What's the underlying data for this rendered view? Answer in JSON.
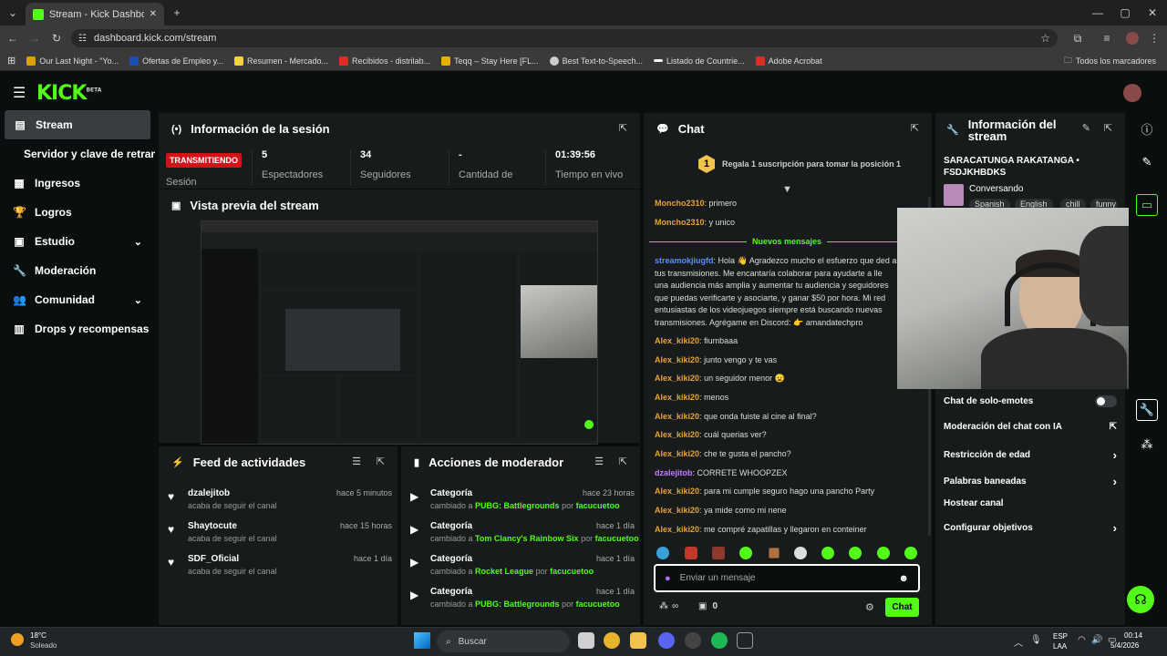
{
  "browser": {
    "tab_title": "Stream - Kick Dashboard",
    "url": "dashboard.kick.com/stream",
    "bookmarks": [
      "Our Last Night - \"Yo...",
      "Ofertas de Empleo y...",
      "Resumen - Mercado...",
      "Recibidos - distrilab...",
      "Teqq – Stay Here [FL...",
      "Best Text-to-Speech...",
      "Listado de Countrie...",
      "Adobe Acrobat"
    ],
    "all_bookmarks": "Todos los marcadores"
  },
  "app": {
    "logo": "KICK",
    "logo_badge": "BETA"
  },
  "sidebar": {
    "items": [
      {
        "label": "Stream"
      },
      {
        "label": "Servidor y clave de retransmisión"
      },
      {
        "label": "Ingresos"
      },
      {
        "label": "Logros"
      },
      {
        "label": "Estudio"
      },
      {
        "label": "Moderación"
      },
      {
        "label": "Comunidad"
      },
      {
        "label": "Drops y recompensas"
      }
    ]
  },
  "session": {
    "title": "Información de la sesión",
    "live_badge": "TRANSMITIENDO",
    "session_label": "Sesión",
    "stats": [
      {
        "value": "5",
        "label": "Espectadores"
      },
      {
        "value": "34",
        "label": "Seguidores"
      },
      {
        "value": "-",
        "label": "Cantidad de"
      },
      {
        "value": "01:39:56",
        "label": "Tiempo en vivo"
      }
    ]
  },
  "preview": {
    "title": "Vista previa del stream"
  },
  "feed": {
    "title": "Feed de actividades",
    "items": [
      {
        "name": "dzalejitob",
        "action": "acaba de seguir el canal",
        "time": "hace 5 minutos"
      },
      {
        "name": "Shaytocute",
        "action": "acaba de seguir el canal",
        "time": "hace 15 horas"
      },
      {
        "name": "SDF_Oficial",
        "action": "acaba de seguir el canal",
        "time": "hace 1 día"
      }
    ]
  },
  "mod_actions": {
    "title": "Acciones de moderador",
    "items": [
      {
        "name": "Categoría",
        "prefix": "cambiado a",
        "game": "PUBG: Battlegrounds",
        "by": "por",
        "mod": "facucuetoo",
        "time": "hace 23 horas"
      },
      {
        "name": "Categoría",
        "prefix": "cambiado a",
        "game": "Tom Clancy's Rainbow Six",
        "by": "por",
        "mod": "facucuetoo",
        "time": "hace 1 día"
      },
      {
        "name": "Categoría",
        "prefix": "cambiado a",
        "game": "Rocket League",
        "by": "por",
        "mod": "facucuetoo",
        "time": "hace 1 día"
      },
      {
        "name": "Categoría",
        "prefix": "cambiado a",
        "game": "PUBG: Battlegrounds",
        "by": "por",
        "mod": "facucuetoo",
        "time": "hace 1 día"
      }
    ]
  },
  "chat": {
    "title": "Chat",
    "gift_rank": "1",
    "gift_text": "Regala 1 suscripción para tomar la posición 1",
    "new_messages": "Nuevos mensajes",
    "messages_before": [
      {
        "user": "Moncho2310",
        "text": "primero"
      },
      {
        "user": "Moncho2310",
        "text": "y unico"
      }
    ],
    "spam": {
      "user": "streamokjiugfd",
      "text": "Hola 👋 Agradezco mucho el esfuerzo que ded a tus transmisiones. Me encantaría colaborar para ayudarte a lle una audiencia más amplia y aumentar tu audiencia y seguidores que puedas verificarte y asociarte, y ganar $50 por hora. Mi red entusiastas de los videojuegos siempre está buscando nuevas transmisiones. Agrégame en Discord: 👉 amandatechpro"
    },
    "messages_after": [
      {
        "user": "Alex_kiki20",
        "text": "fiumbaaa"
      },
      {
        "user": "Alex_kiki20",
        "text": "junto vengo y te vas"
      },
      {
        "user": "Alex_kiki20",
        "text": "un seguidor menor 😦"
      },
      {
        "user": "Alex_kiki20",
        "text": "menos"
      },
      {
        "user": "Alex_kiki20",
        "text": "que onda fuiste al cine al final?"
      },
      {
        "user": "Alex_kiki20",
        "text": "cuál querias ver?"
      },
      {
        "user": "Alex_kiki20",
        "text": "che te gusta el pancho?"
      },
      {
        "user": "dzalejitob",
        "text": "CORRETE WHOOPZEX"
      },
      {
        "user": "Alex_kiki20",
        "text": "para mi cumple seguro hago una pancho Party"
      },
      {
        "user": "Alex_kiki20",
        "text": "ya mide como mi nene"
      },
      {
        "user": "Alex_kiki20",
        "text": "me compré zapatillas y llegaron en conteiner"
      }
    ],
    "placeholder": "Enviar un mensaje",
    "points": "∞",
    "count": "0",
    "send": "Chat"
  },
  "stream_info": {
    "title": "Información del stream",
    "stream_title": "SARACATUNGA RAKATANGA • FSDJKHBDKS",
    "category": "Conversando",
    "tags": [
      "Spanish",
      "English",
      "chill",
      "funny"
    ],
    "settings": [
      {
        "label": "Chat de solo-emotes"
      },
      {
        "label": "Moderación del chat con IA"
      },
      {
        "label": "Restricción de edad"
      },
      {
        "label": "Palabras baneadas"
      },
      {
        "label": "Hostear canal"
      },
      {
        "label": "Configurar objetivos"
      }
    ]
  },
  "taskbar": {
    "weather_temp": "18°C",
    "weather_desc": "Soleado",
    "search": "Buscar",
    "lang": "ESP",
    "lang2": "LAA",
    "time": "00:14",
    "date": "5/4/2026"
  },
  "colors": {
    "accent": "#53fc18",
    "live": "#d4121a",
    "bg": "#0b0e0f",
    "panel": "#181b1c"
  }
}
